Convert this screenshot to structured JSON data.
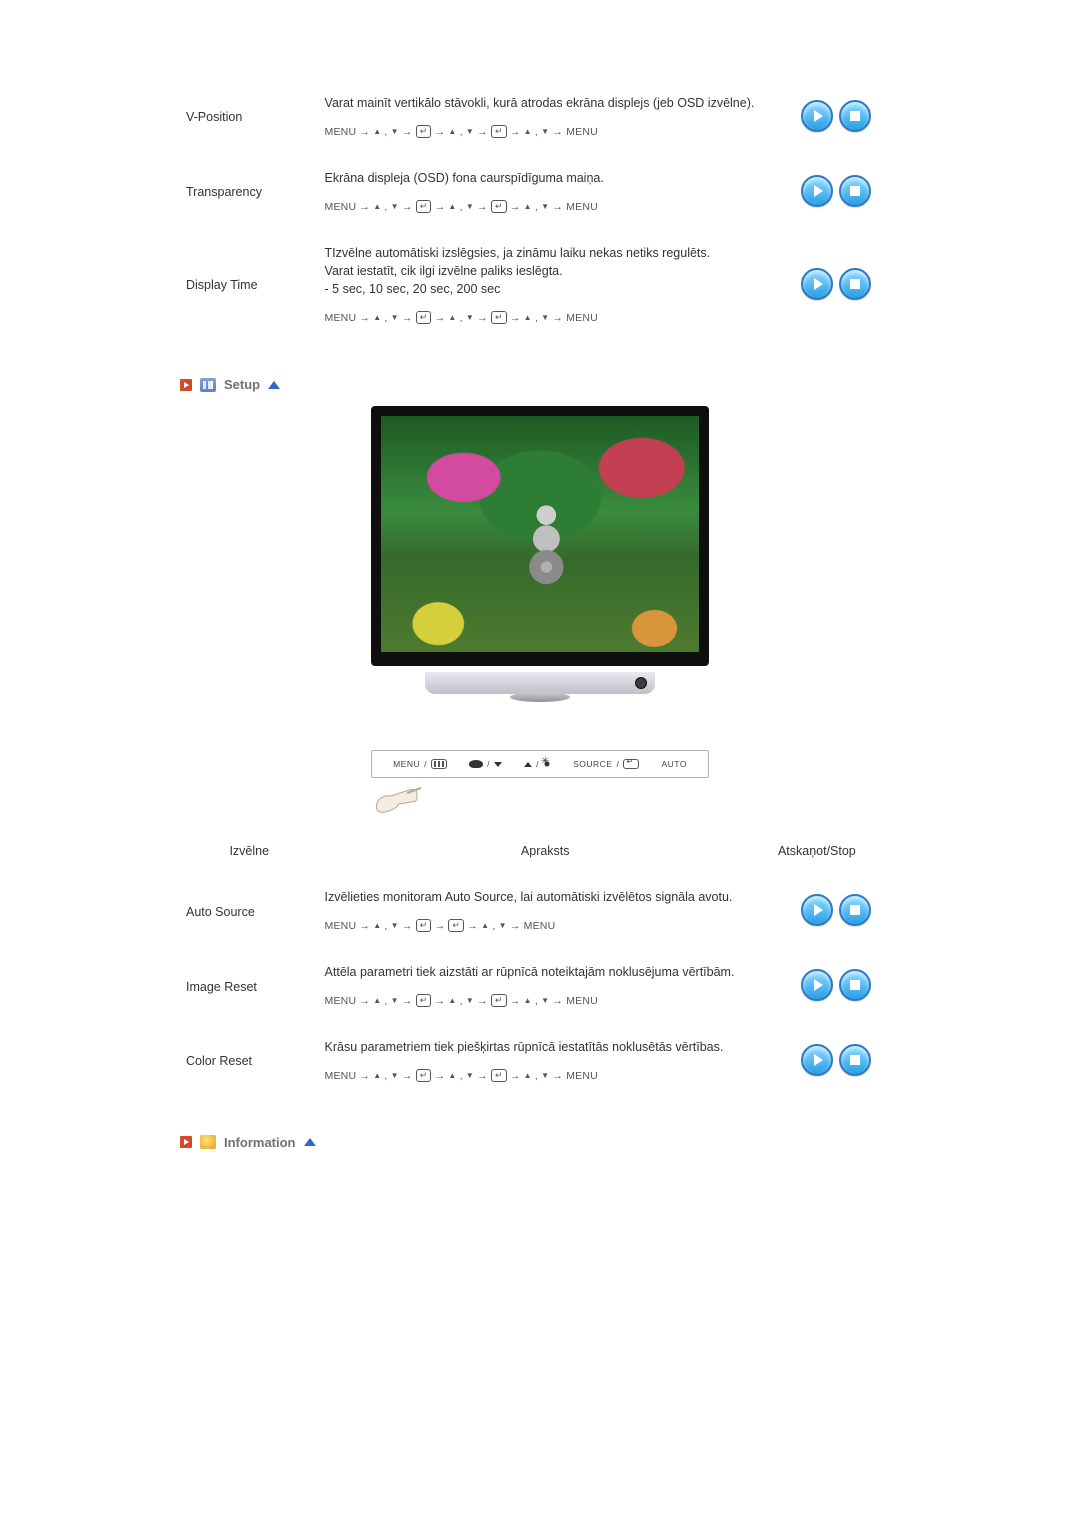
{
  "osd_rows": [
    {
      "name": "V-Position",
      "desc": "Varat mainīt vertikālo stāvokli, kurā atrodas ekrāna displejs (jeb OSD izvēlne).",
      "path_type": "standard"
    },
    {
      "name": "Transparency",
      "desc": "Ekrāna displeja (OSD) fona caurspīdīguma maiņa.",
      "path_type": "standard"
    },
    {
      "name": "Display Time",
      "desc": "TIzvēlne automātiski izslēgsies, ja zināmu laiku nekas netiks regulēts.\nVarat iestatīt, cik ilgi izvēlne paliks ieslēgta.\n- 5 sec, 10 sec, 20 sec, 200 sec",
      "path_type": "standard"
    }
  ],
  "sections": {
    "setup": "Setup",
    "information": "Information"
  },
  "control_panel": {
    "menu": "MENU",
    "source": "SOURCE",
    "auto": "AUTO"
  },
  "setup_table": {
    "headers": {
      "menu": "Izvēlne",
      "desc": "Apraksts",
      "action": "Atskaņot/Stop"
    },
    "rows": [
      {
        "name": "Auto Source",
        "desc": "Izvēlieties monitoram Auto Source, lai automātiski izvēlētos signāla avotu.",
        "path_type": "short"
      },
      {
        "name": "Image Reset",
        "desc": "Attēla parametri tiek aizstāti ar rūpnīcā noteiktajām noklusējuma vērtībām.",
        "path_type": "standard"
      },
      {
        "name": "Color Reset",
        "desc": "Krāsu parametriem tiek piešķirtas rūpnīcā iestatītās noklusētās vērtības.",
        "path_type": "standard"
      }
    ]
  },
  "labels": {
    "menu_word": "MENU",
    "arrow": "→"
  }
}
